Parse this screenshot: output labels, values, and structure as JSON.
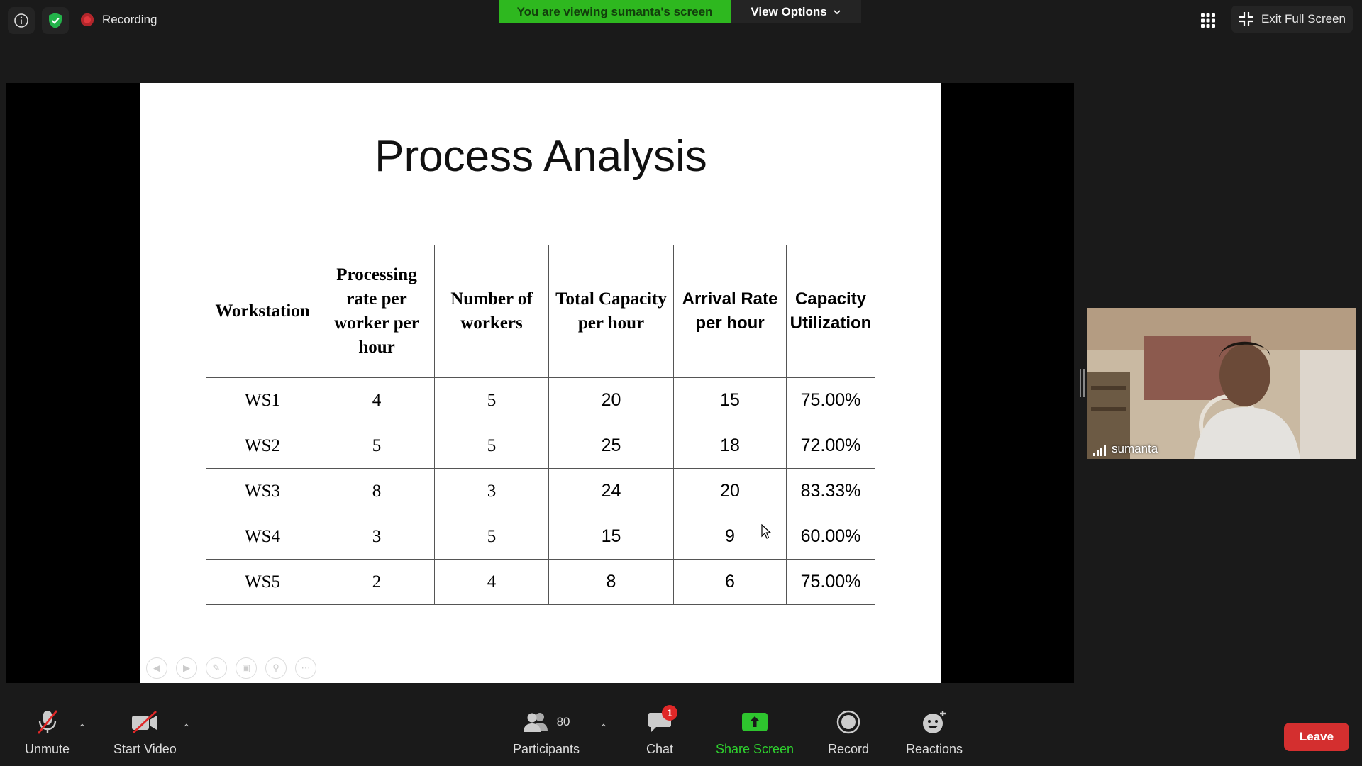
{
  "top": {
    "recording_label": "Recording",
    "banner_text": "You are viewing sumanta's screen",
    "view_options_label": "View Options",
    "exit_fullscreen_label": "Exit Full Screen"
  },
  "slide": {
    "title": "Process Analysis",
    "table": {
      "headers": [
        "Workstation",
        "Processing rate per worker per hour",
        "Number of workers",
        "Total Capacity per hour",
        "Arrival Rate per hour",
        "Capacity Utilization"
      ],
      "rows": [
        [
          "WS1",
          "4",
          "5",
          "20",
          "15",
          "75.00%"
        ],
        [
          "WS2",
          "5",
          "5",
          "25",
          "18",
          "72.00%"
        ],
        [
          "WS3",
          "8",
          "3",
          "24",
          "20",
          "83.33%"
        ],
        [
          "WS4",
          "3",
          "5",
          "15",
          "9",
          "60.00%"
        ],
        [
          "WS5",
          "2",
          "4",
          "8",
          "6",
          "75.00%"
        ]
      ]
    }
  },
  "video": {
    "participant_name": "sumanta"
  },
  "toolbar": {
    "unmute_label": "Unmute",
    "start_video_label": "Start Video",
    "participants_count": "80",
    "participants_label": "Participants",
    "chat_label": "Chat",
    "chat_badge": "1",
    "share_screen_label": "Share Screen",
    "record_label": "Record",
    "reactions_label": "Reactions",
    "leave_label": "Leave"
  },
  "colors": {
    "banner_green": "#2eb81f",
    "share_green": "#2ed12e",
    "leave_red": "#d42f2f",
    "badge_red": "#e02828"
  }
}
